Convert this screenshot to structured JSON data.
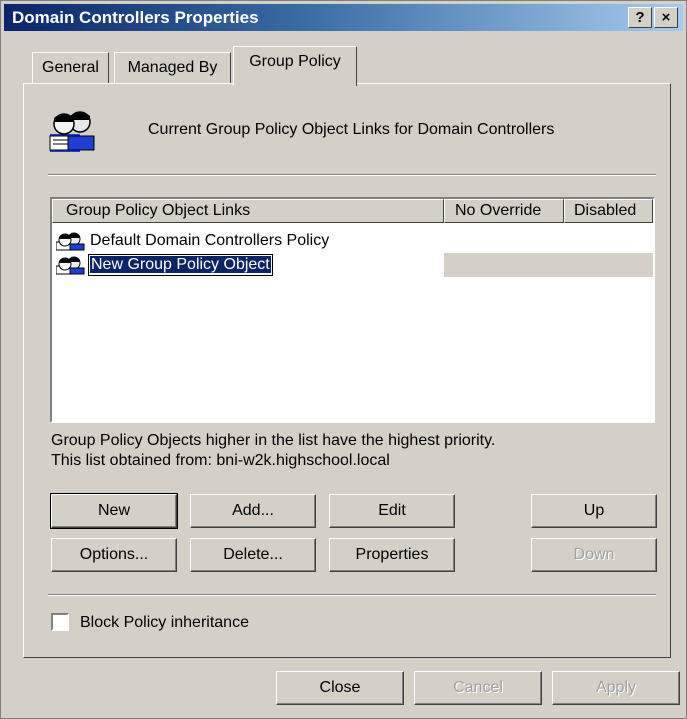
{
  "window": {
    "title": "Domain Controllers Properties",
    "help_label": "?",
    "close_label": "×"
  },
  "tabs": [
    {
      "label": "General"
    },
    {
      "label": "Managed By"
    },
    {
      "label": "Group Policy"
    }
  ],
  "header": {
    "icon": "group-users-icon",
    "text": "Current Group Policy Object Links for Domain Controllers"
  },
  "list": {
    "columns": [
      "Group Policy Object Links",
      "No Override",
      "Disabled"
    ],
    "rows": [
      {
        "name": "Default Domain Controllers Policy",
        "icon": "gpo-icon"
      },
      {
        "name": "New Group Policy Object",
        "icon": "gpo-icon",
        "editing": true
      }
    ]
  },
  "info": {
    "line1": "Group Policy Objects higher in the list have the highest priority.",
    "line2": "This list obtained from: bni-w2k.highschool.local"
  },
  "buttons": {
    "new": "New",
    "add": "Add...",
    "edit": "Edit",
    "up": "Up",
    "options": "Options...",
    "delete": "Delete...",
    "properties": "Properties",
    "down": "Down"
  },
  "block_inheritance": {
    "label": "Block Policy inheritance",
    "checked": false
  },
  "footer": {
    "close": "Close",
    "cancel": "Cancel",
    "apply": "Apply"
  }
}
